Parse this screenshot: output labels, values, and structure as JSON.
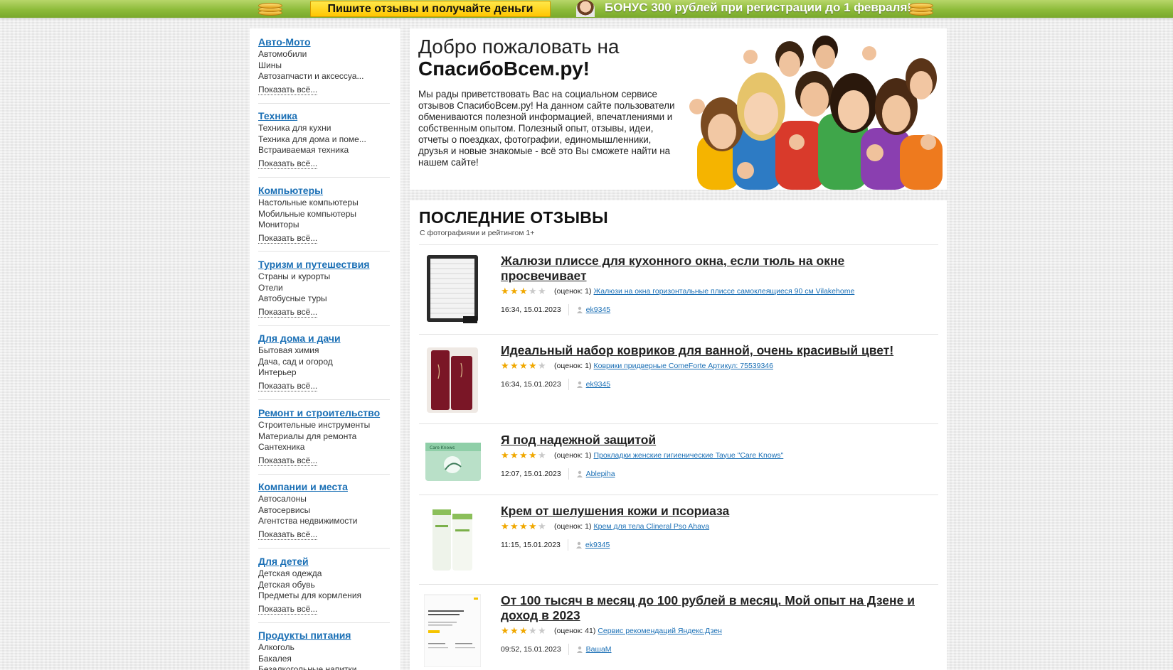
{
  "promo": {
    "cta": "Пишите отзывы и получайте деньги",
    "bonus": "БОНУС 300 рублей при регистрации до 1 февраля!"
  },
  "sidebar": {
    "more_label": "Показать всё...",
    "categories": [
      {
        "title": "Авто-Мото",
        "items": [
          "Автомобили",
          "Шины",
          "Автозапчасти и аксессуа..."
        ]
      },
      {
        "title": "Техника",
        "items": [
          "Техника для кухни",
          "Техника для дома и поме...",
          "Встраиваемая техника"
        ]
      },
      {
        "title": "Компьютеры",
        "items": [
          "Настольные компьютеры",
          "Мобильные компьютеры",
          "Мониторы"
        ]
      },
      {
        "title": "Туризм и путешествия",
        "items": [
          "Страны и курорты",
          "Отели",
          "Автобусные туры"
        ]
      },
      {
        "title": "Для дома и дачи",
        "items": [
          "Бытовая химия",
          "Дача, сад и огород",
          "Интерьер"
        ]
      },
      {
        "title": "Ремонт и строительство",
        "items": [
          "Строительные инструменты",
          "Материалы для ремонта",
          "Сантехника"
        ]
      },
      {
        "title": "Компании и места",
        "items": [
          "Автосалоны",
          "Автосервисы",
          "Агентства недвижимости"
        ]
      },
      {
        "title": "Для детей",
        "items": [
          "Детская одежда",
          "Детская обувь",
          "Предметы для кормления"
        ]
      },
      {
        "title": "Продукты питания",
        "items": [
          "Алкоголь",
          "Бакалея",
          "Безалкогольные напитки"
        ]
      }
    ]
  },
  "welcome": {
    "heading_line1": "Добро пожаловать на",
    "heading_line2": "СпасибоВсем.ру!",
    "text": "Мы рады приветствовать Вас на социальном сервисе отзывов СпасибоВсем.ру! На данном сайте пользователи обмениваются полезной информацией, впечатлениями и собственным опытом. Полезный опыт, отзывы, идеи, отчеты о поездках, фотографии, единомышленники, друзья и новые знакомые - всё это Вы сможете найти на нашем сайте!"
  },
  "reviews": {
    "title": "ПОСЛЕДНИЕ ОТЗЫВЫ",
    "subtitle": "С фотографиями и рейтингом 1+",
    "items": [
      {
        "title": "Жалюзи плиссе для кухонного окна, если тюль на окне просвечивает",
        "rating": 3,
        "count": "(оценок: 1)",
        "product": "Жалюзи на окна горизонтальные плиссе самоклеящиеся 90 см Vilakehome",
        "time": "16:34, 15.01.2023",
        "user": "ek9345"
      },
      {
        "title": "Идеальный набор ковриков для ванной, очень красивый цвет!",
        "rating": 4,
        "count": "(оценок: 1)",
        "product": "Коврики придверные ComeForte Артикул: 75539346",
        "time": "16:34, 15.01.2023",
        "user": "ek9345"
      },
      {
        "title": "Я под надежной защитой",
        "rating": 4,
        "count": "(оценок: 1)",
        "product": "Прокладки женские гигиенические Tayue \"Care Knows\"",
        "time": "12:07, 15.01.2023",
        "user": "Ablepiha"
      },
      {
        "title": "Крем от шелушения кожи и псориаза",
        "rating": 4,
        "count": "(оценок: 1)",
        "product": "Крем для тела Clineral Pso Ahava",
        "time": "11:15, 15.01.2023",
        "user": "ek9345"
      },
      {
        "title": "От 100 тысяч в месяц до 100 рублей в месяц. Мой опыт на Дзене и доход в 2023",
        "rating": 3,
        "count": "(оценок: 41)",
        "product": "Сервис рекомендаций Яндекс.Дзен",
        "time": "09:52, 15.01.2023",
        "user": "ВашаМ"
      }
    ]
  },
  "colors": {
    "link": "#1a6fb5",
    "star": "#f0a800",
    "banner_green": "#8dbb3a",
    "cta_yellow": "#ffc600"
  }
}
